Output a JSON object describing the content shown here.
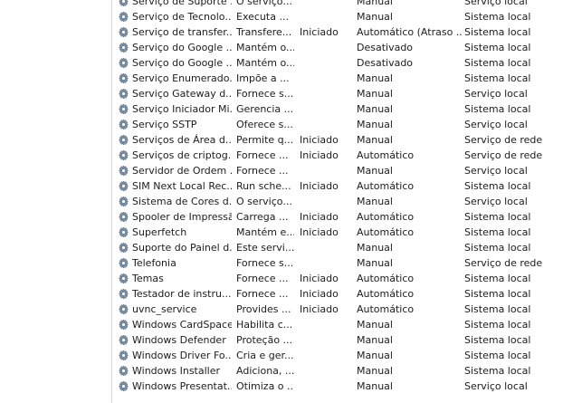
{
  "services": [
    {
      "name": "Serviço de Suporte ...",
      "description": "O serviço...",
      "status": "",
      "startup": "Manual",
      "logon": "Serviço local"
    },
    {
      "name": "Serviço de Tecnolo...",
      "description": "Executa ...",
      "status": "",
      "startup": "Manual",
      "logon": "Sistema local"
    },
    {
      "name": "Serviço de transfer...",
      "description": "Transfere...",
      "status": "Iniciado",
      "startup": "Automático (Atraso ...",
      "logon": "Sistema local"
    },
    {
      "name": "Serviço do Google ...",
      "description": "Mantém o...",
      "status": "",
      "startup": "Desativado",
      "logon": "Sistema local"
    },
    {
      "name": "Serviço do Google ...",
      "description": "Mantém o...",
      "status": "",
      "startup": "Desativado",
      "logon": "Sistema local"
    },
    {
      "name": "Serviço Enumerado...",
      "description": "Impõe a ...",
      "status": "",
      "startup": "Manual",
      "logon": "Sistema local"
    },
    {
      "name": "Serviço Gateway d...",
      "description": "Fornece s...",
      "status": "",
      "startup": "Manual",
      "logon": "Serviço local"
    },
    {
      "name": "Serviço Iniciador Mi...",
      "description": "Gerencia ...",
      "status": "",
      "startup": "Manual",
      "logon": "Sistema local"
    },
    {
      "name": "Serviço SSTP",
      "description": "Oferece s...",
      "status": "",
      "startup": "Manual",
      "logon": "Serviço local"
    },
    {
      "name": "Serviços de Área d...",
      "description": "Permite q...",
      "status": "Iniciado",
      "startup": "Manual",
      "logon": "Serviço de rede"
    },
    {
      "name": "Serviços de criptog...",
      "description": "Fornece ...",
      "status": "Iniciado",
      "startup": "Automático",
      "logon": "Serviço de rede"
    },
    {
      "name": "Servidor de Ordem ...",
      "description": "Fornece ...",
      "status": "",
      "startup": "Manual",
      "logon": "Serviço local"
    },
    {
      "name": "SIM Next Local Rec...",
      "description": "Run sche...",
      "status": "Iniciado",
      "startup": "Automático",
      "logon": "Sistema local"
    },
    {
      "name": "Sistema de Cores d...",
      "description": "O serviço...",
      "status": "",
      "startup": "Manual",
      "logon": "Serviço local"
    },
    {
      "name": "Spooler de Impressão",
      "description": "Carrega ...",
      "status": "Iniciado",
      "startup": "Automático",
      "logon": "Sistema local"
    },
    {
      "name": "Superfetch",
      "description": "Mantém e...",
      "status": "Iniciado",
      "startup": "Automático",
      "logon": "Sistema local"
    },
    {
      "name": "Suporte do Painel d...",
      "description": "Este servi...",
      "status": "",
      "startup": "Manual",
      "logon": "Sistema local"
    },
    {
      "name": "Telefonia",
      "description": "Fornece s...",
      "status": "",
      "startup": "Manual",
      "logon": "Serviço de rede"
    },
    {
      "name": "Temas",
      "description": "Fornece ...",
      "status": "Iniciado",
      "startup": "Automático",
      "logon": "Sistema local"
    },
    {
      "name": "Testador de instru...",
      "description": "Fornece ...",
      "status": "Iniciado",
      "startup": "Automático",
      "logon": "Sistema local"
    },
    {
      "name": "uvnc_service",
      "description": "Provides ...",
      "status": "Iniciado",
      "startup": "Automático",
      "logon": "Sistema local"
    },
    {
      "name": "Windows CardSpace",
      "description": "Habilita c...",
      "status": "",
      "startup": "Manual",
      "logon": "Sistema local"
    },
    {
      "name": "Windows Defender",
      "description": "Proteção ...",
      "status": "",
      "startup": "Manual",
      "logon": "Sistema local"
    },
    {
      "name": "Windows Driver Fo...",
      "description": "Cria e ger...",
      "status": "",
      "startup": "Manual",
      "logon": "Sistema local"
    },
    {
      "name": "Windows Installer",
      "description": "Adiciona, ...",
      "status": "",
      "startup": "Manual",
      "logon": "Sistema local"
    },
    {
      "name": "Windows Presentat...",
      "description": "Otimiza o ...",
      "status": "",
      "startup": "Manual",
      "logon": "Serviço local"
    }
  ],
  "icon": "gear-icon",
  "colors": {
    "text": "#1c1c1c",
    "background": "#ffffff",
    "divider": "#d8d8d8",
    "gear": "#7a8ea4"
  }
}
